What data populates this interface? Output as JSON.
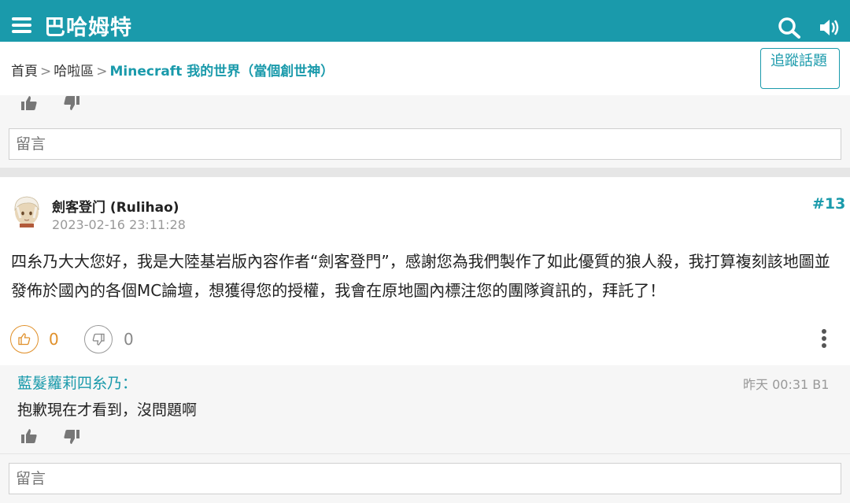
{
  "app": {
    "title": "巴哈姆特"
  },
  "breadcrumb": {
    "home": "首頁",
    "separator": ">",
    "board": "哈啦區",
    "current": "Minecraft 我的世界（當個創世神）"
  },
  "follow_button": {
    "label": "追蹤話題"
  },
  "comment": {
    "placeholder": "留言"
  },
  "post": {
    "author": "劍客登门 (Rulihao)",
    "time": "2023-02-16 23:11:28",
    "floor": "#13",
    "body": "四糸乃大大您好，我是大陸基岩版內容作者“劍客登門”，感謝您為我們製作了如此優質的狼人殺，我打算複刻該地圖並發佈於國內的各個MC論壇，想獲得您的授權，我會在原地圖內標注您的團隊資訊的，拜託了！",
    "likes": "0",
    "dislikes": "0"
  },
  "reply": {
    "user": "藍髮蘿莉四糸乃：",
    "meta": "昨天 00:31 B1",
    "text": "抱歉現在才看到，沒問題啊"
  },
  "colors": {
    "brand": "#1a9aab",
    "like": "#e0902a"
  },
  "icons": [
    "menu-icon",
    "search-icon",
    "speaker-icon",
    "thumbs-up-icon",
    "thumbs-down-icon",
    "more-vertical-icon",
    "avatar"
  ]
}
